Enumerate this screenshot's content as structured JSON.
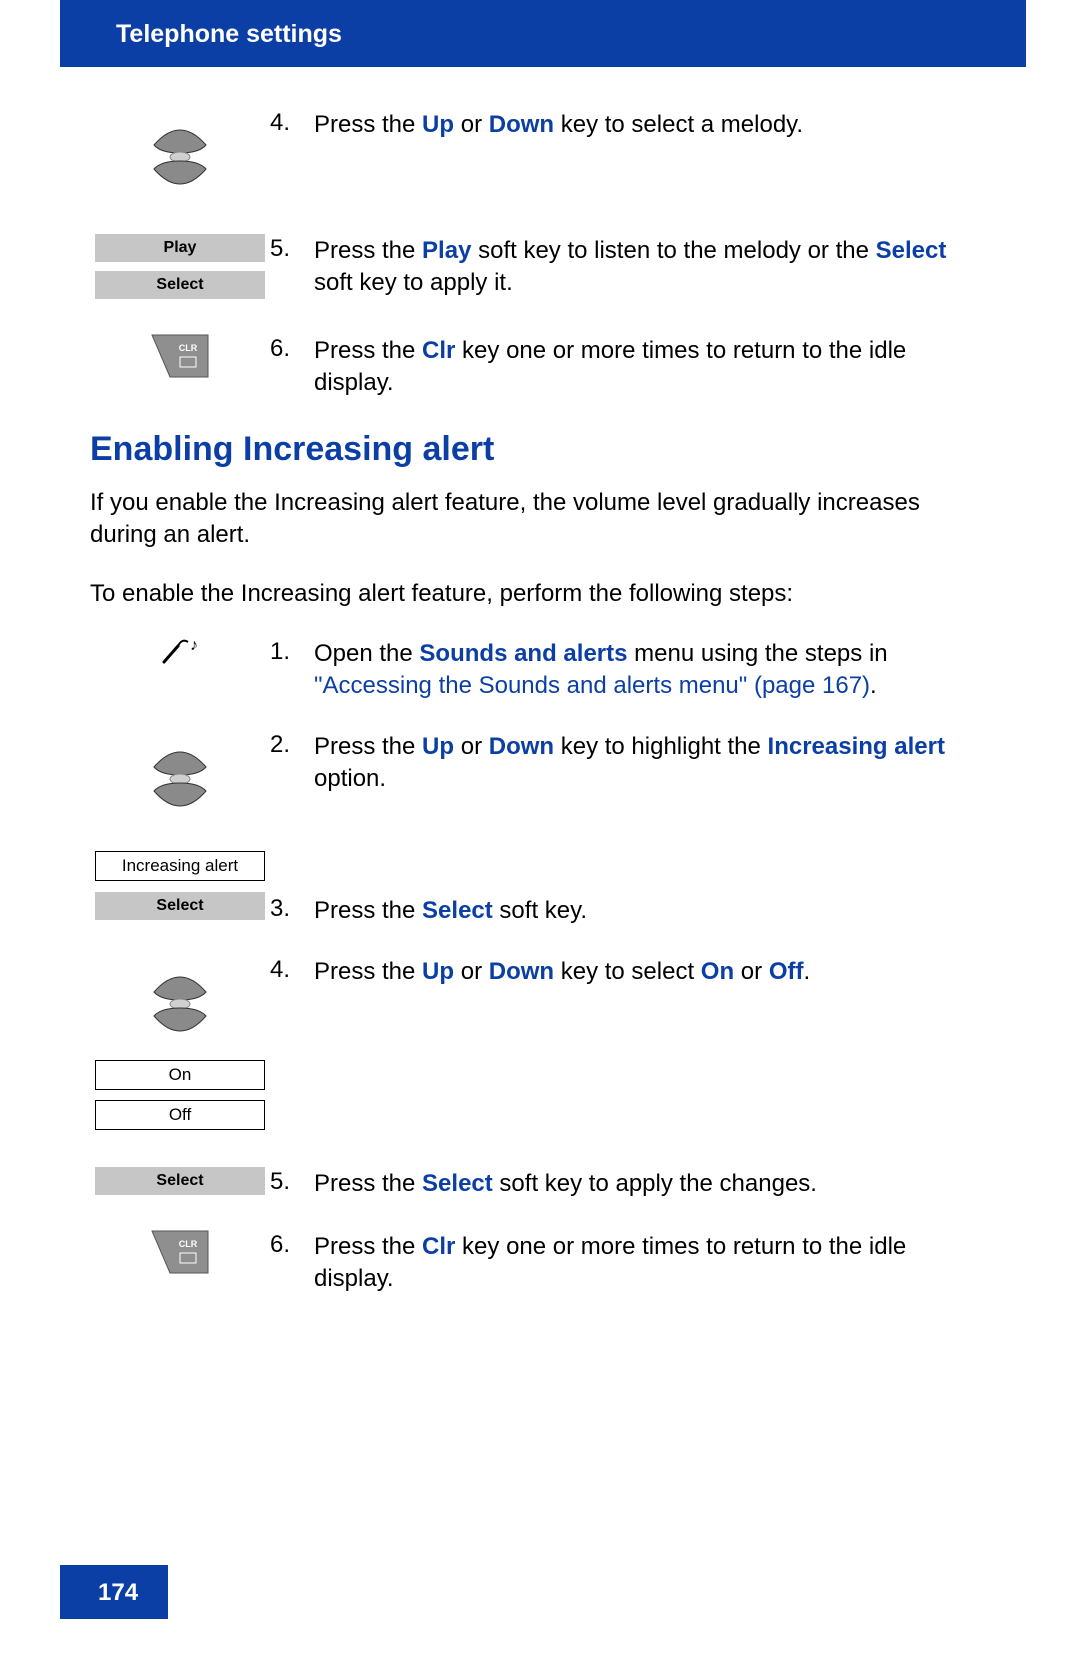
{
  "header": {
    "title": "Telephone settings"
  },
  "stepsA": [
    {
      "num": "4.",
      "parts": [
        {
          "t": "Press the ",
          "c": ""
        },
        {
          "t": "Up",
          "c": "bold-blue"
        },
        {
          "t": " or ",
          "c": ""
        },
        {
          "t": "Down",
          "c": "bold-blue"
        },
        {
          "t": " key to select a melody.",
          "c": ""
        }
      ]
    },
    {
      "num": "5.",
      "parts": [
        {
          "t": "Press the ",
          "c": ""
        },
        {
          "t": "Play",
          "c": "bold-blue"
        },
        {
          "t": " soft key to listen to the melody or the ",
          "c": ""
        },
        {
          "t": "Select",
          "c": "bold-blue"
        },
        {
          "t": " soft key to apply it.",
          "c": ""
        }
      ]
    },
    {
      "num": "6.",
      "parts": [
        {
          "t": "Press the ",
          "c": ""
        },
        {
          "t": "Clr",
          "c": "bold-blue"
        },
        {
          "t": " key one or more times to return to the idle display.",
          "c": ""
        }
      ]
    }
  ],
  "section": {
    "title": "Enabling Increasing alert",
    "p1": "If you enable the Increasing alert feature, the volume level gradually increases during an alert.",
    "p2": "To enable the Increasing alert feature, perform the following steps:"
  },
  "stepsB": [
    {
      "num": "1.",
      "parts": [
        {
          "t": "Open the ",
          "c": ""
        },
        {
          "t": "Sounds and alerts",
          "c": "bold-blue"
        },
        {
          "t": " menu using the steps in ",
          "c": ""
        },
        {
          "t": "\"Accessing the Sounds and alerts menu\" (page 167)",
          "c": "link-blue"
        },
        {
          "t": ".",
          "c": ""
        }
      ]
    },
    {
      "num": "2.",
      "parts": [
        {
          "t": "Press the ",
          "c": ""
        },
        {
          "t": "Up",
          "c": "bold-blue"
        },
        {
          "t": " or ",
          "c": ""
        },
        {
          "t": "Down",
          "c": "bold-blue"
        },
        {
          "t": " key to highlight the ",
          "c": ""
        },
        {
          "t": "Increasing alert",
          "c": "bold-blue"
        },
        {
          "t": " option.",
          "c": ""
        }
      ]
    },
    {
      "num": "3.",
      "parts": [
        {
          "t": "Press the ",
          "c": ""
        },
        {
          "t": "Select",
          "c": "bold-blue"
        },
        {
          "t": " soft key.",
          "c": ""
        }
      ]
    },
    {
      "num": "4.",
      "parts": [
        {
          "t": "Press the ",
          "c": ""
        },
        {
          "t": "Up",
          "c": "bold-blue"
        },
        {
          "t": " or ",
          "c": ""
        },
        {
          "t": "Down",
          "c": "bold-blue"
        },
        {
          "t": " key to select ",
          "c": ""
        },
        {
          "t": "On",
          "c": "bold-blue"
        },
        {
          "t": " or ",
          "c": ""
        },
        {
          "t": "Off",
          "c": "bold-blue"
        },
        {
          "t": ".",
          "c": ""
        }
      ]
    },
    {
      "num": "5.",
      "parts": [
        {
          "t": "Press the ",
          "c": ""
        },
        {
          "t": "Select",
          "c": "bold-blue"
        },
        {
          "t": " soft key to apply the changes.",
          "c": ""
        }
      ]
    },
    {
      "num": "6.",
      "parts": [
        {
          "t": "Press the ",
          "c": ""
        },
        {
          "t": "Clr",
          "c": "bold-blue"
        },
        {
          "t": " key one or more times to return to the idle display.",
          "c": ""
        }
      ]
    }
  ],
  "labels": {
    "play": "Play",
    "select": "Select",
    "increasing_alert": "Increasing alert",
    "on": "On",
    "off": "Off",
    "clr": "CLR"
  },
  "page_number": "174"
}
